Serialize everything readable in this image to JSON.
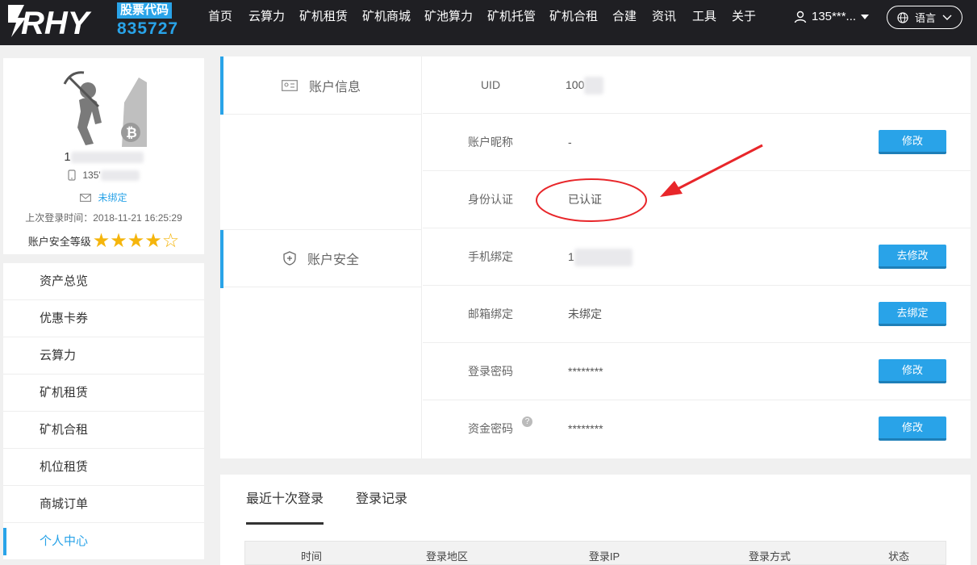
{
  "colors": {
    "accent": "#29a3e8",
    "nav_bg": "#1f1f23",
    "star": "#f5b50c",
    "annotation": "#e8262a"
  },
  "header": {
    "stock_label": "股票代码",
    "stock_code": "835727",
    "nav": [
      "首页",
      "云算力",
      "矿机租赁",
      "矿机商城",
      "矿池算力",
      "矿机托管",
      "矿机合租",
      "合建",
      "资讯",
      "工具",
      "关于"
    ],
    "user": "135***...",
    "language": "语言"
  },
  "profile": {
    "name_visible": "1",
    "phone_visible": "135'",
    "email_status": "未绑定",
    "last_login_label": "上次登录时间：",
    "last_login_time": "2018-11-21 16:25:29",
    "security_level_label": "账户安全等级",
    "security_stars_filled": 4,
    "security_stars_total": 5,
    "stars_text": "★★★★☆"
  },
  "side_menu": {
    "items": [
      "资产总览",
      "优惠卡券",
      "云算力",
      "矿机租赁",
      "矿机合租",
      "机位租赁",
      "商城订单",
      "个人中心"
    ],
    "active_index": 7
  },
  "sections": {
    "account_info": "账户信息",
    "account_security": "账户安全"
  },
  "rows": [
    {
      "label": "UID",
      "value": "100",
      "button": ""
    },
    {
      "label": "账户昵称",
      "value": "-",
      "button": "修改"
    },
    {
      "label": "身份认证",
      "value": "已认证",
      "button": ""
    },
    {
      "label": "手机绑定",
      "value": "1",
      "button": "去修改"
    },
    {
      "label": "邮箱绑定",
      "value": "未绑定",
      "button": "去绑定"
    },
    {
      "label": "登录密码",
      "value": "********",
      "button": "修改"
    },
    {
      "label": "资金密码",
      "value": "********",
      "button": "修改"
    }
  ],
  "help_glyph": "?",
  "login": {
    "tabs": [
      "最近十次登录",
      "登录记录"
    ],
    "columns": [
      "时间",
      "登录地区",
      "登录IP",
      "登录方式",
      "状态"
    ]
  }
}
